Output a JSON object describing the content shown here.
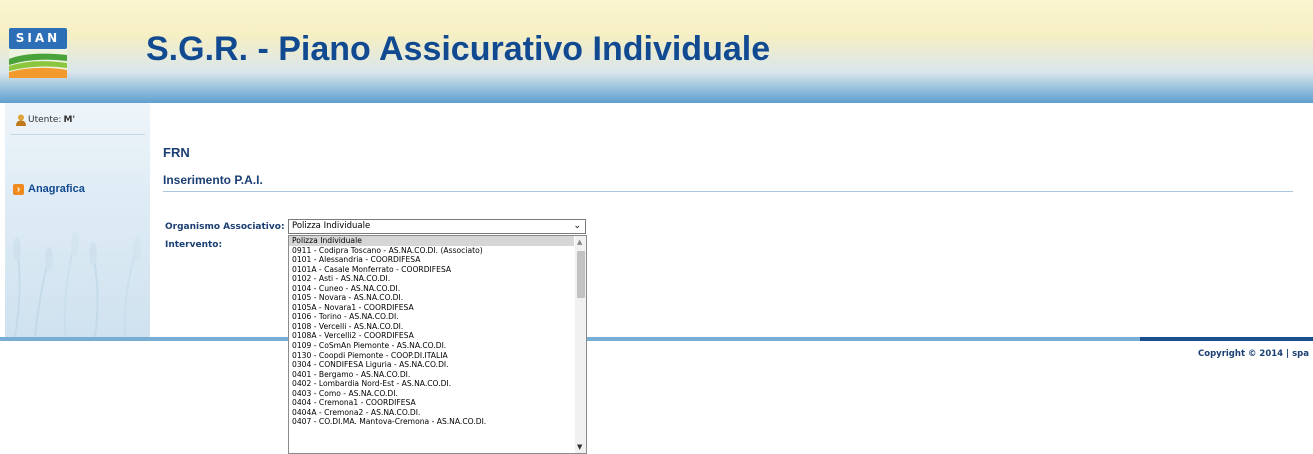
{
  "header": {
    "logo_text": "SIAN",
    "title": "S.G.R. - Piano Assicurativo Individuale",
    "colors": {
      "title": "#114a91",
      "logo": "#2c6fb6"
    }
  },
  "sidebar": {
    "user_label": "Utente:",
    "user_value": "M'",
    "menu": [
      {
        "label": "Anagrafica",
        "icon": "arrow-right-icon"
      }
    ]
  },
  "main": {
    "section": "FRN",
    "page_title": "Inserimento P.A.I.",
    "form": {
      "organismo_label": "Organismo Associativo:",
      "organismo_value": "Polizza Individuale",
      "intervento_label": "Intervento:"
    }
  },
  "dropdown": {
    "options": [
      "Polizza Individuale",
      "0911 - Codipra Toscano - AS.NA.CO.DI. (Associato)",
      "0101 - Alessandria - COORDIFESA",
      "0101A - Casale Monferrato - COORDIFESA",
      "0102 - Asti - AS.NA.CO.DI.",
      "0104 - Cuneo - AS.NA.CO.DI.",
      "0105 - Novara - AS.NA.CO.DI.",
      "0105A - Novara1 - COORDIFESA",
      "0106 - Torino - AS.NA.CO.DI.",
      "0108 - Vercelli - AS.NA.CO.DI.",
      "0108A - Vercelli2 - COORDIFESA",
      "0109 - CoSmAn Piemonte - AS.NA.CO.DI.",
      "0130 - Coopdi Piemonte - COOP.DI.ITALIA",
      "0304 - CONDIFESA Liguria - AS.NA.CO.DI.",
      "0401 - Bergamo - AS.NA.CO.DI.",
      "0402 - Lombardia Nord-Est - AS.NA.CO.DI.",
      "0403 - Como - AS.NA.CO.DI.",
      "0404 - Cremona1 - COORDIFESA",
      "0404A - Cremona2 - AS.NA.CO.DI.",
      "0407 - CO.DI.MA. Mantova-Cremona - AS.NA.CO.DI."
    ]
  },
  "footer": {
    "copyright": "Copyright © 2014 | spa"
  }
}
